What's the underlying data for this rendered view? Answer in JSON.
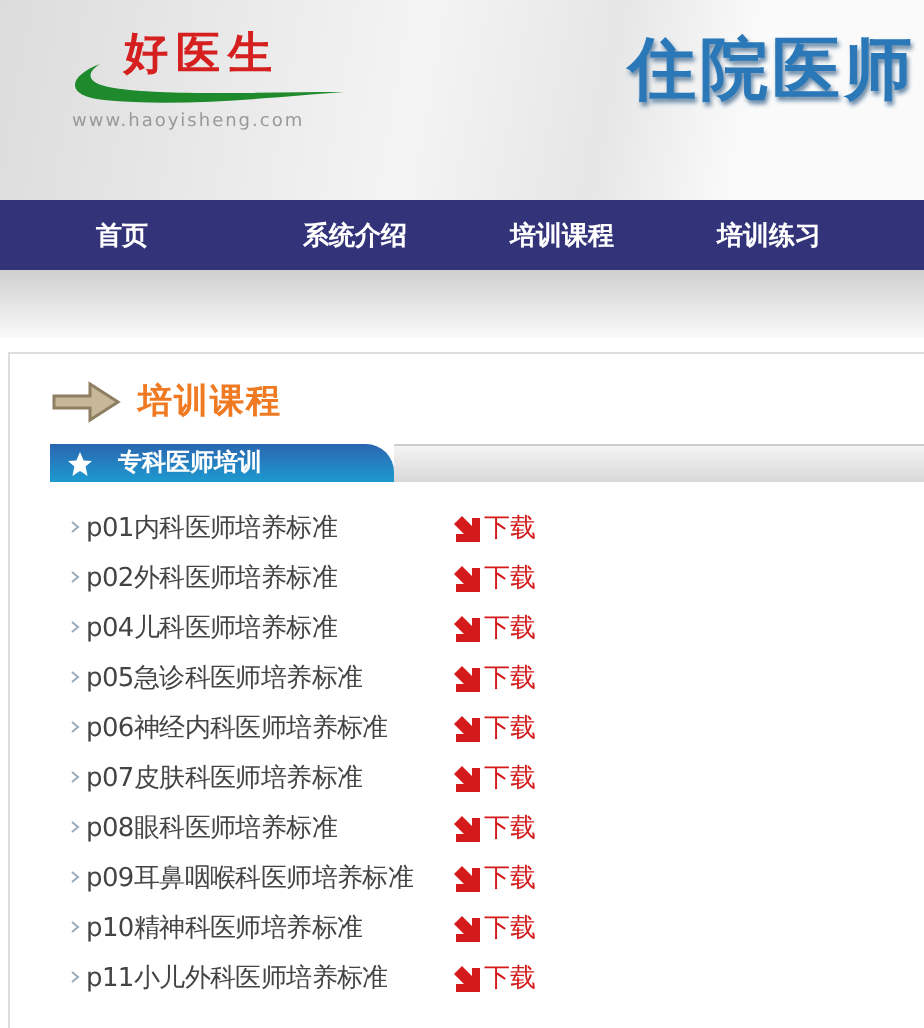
{
  "header": {
    "logo_text": "好医生",
    "logo_url": "www.haoyisheng.com",
    "title": "住院医师"
  },
  "nav": [
    {
      "label": "首页"
    },
    {
      "label": "系统介绍"
    },
    {
      "label": "培训课程"
    },
    {
      "label": "培训练习"
    }
  ],
  "page_heading": "培训课程",
  "section": {
    "title": "专科医师培训"
  },
  "courses": [
    {
      "name": "p01内科医师培养标准",
      "link": "下载"
    },
    {
      "name": "p02外科医师培养标准",
      "link": "下载"
    },
    {
      "name": "p04儿科医师培养标准",
      "link": "下载"
    },
    {
      "name": "p05急诊科医师培养标准",
      "link": "下载"
    },
    {
      "name": "p06神经内科医师培养标准",
      "link": "下载"
    },
    {
      "name": "p07皮肤科医师培养标准",
      "link": "下载"
    },
    {
      "name": "p08眼科医师培养标准",
      "link": "下载"
    },
    {
      "name": "p09耳鼻咽喉科医师培养标准",
      "link": "下载"
    },
    {
      "name": "p10精神科医师培养标准",
      "link": "下载"
    },
    {
      "name": "p11小儿外科医师培养标准",
      "link": "下载"
    }
  ]
}
